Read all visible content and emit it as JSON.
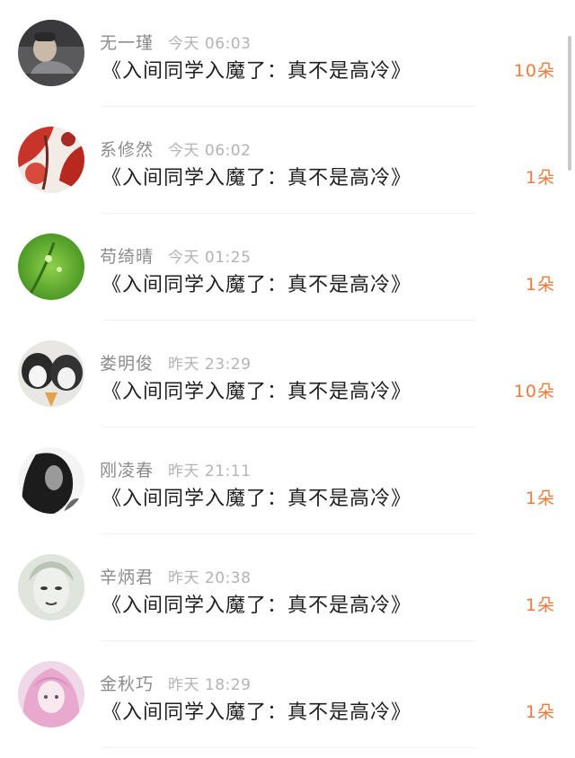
{
  "rows": [
    {
      "name": "无一瑾",
      "time": "今天 06:03",
      "title": "《入间同学入魔了：真不是高冷》",
      "count": "10朵",
      "avatar": "avatar-gray-person"
    },
    {
      "name": "系修然",
      "time": "今天 06:02",
      "title": "《入间同学入魔了：真不是高冷》",
      "count": "1朵",
      "avatar": "avatar-red-floral"
    },
    {
      "name": "苟绮晴",
      "time": "今天 01:25",
      "title": "《入间同学入魔了：真不是高冷》",
      "count": "1朵",
      "avatar": "avatar-green-plant"
    },
    {
      "name": "娄明俊",
      "time": "昨天 23:29",
      "title": "《入间同学入魔了：真不是高冷》",
      "count": "10朵",
      "avatar": "avatar-husky-dogs"
    },
    {
      "name": "刚凌春",
      "time": "昨天 21:11",
      "title": "《入间同学入魔了：真不是高冷》",
      "count": "1朵",
      "avatar": "avatar-bw-girl"
    },
    {
      "name": "辛炳君",
      "time": "昨天 20:38",
      "title": "《入间同学入魔了：真不是高冷》",
      "count": "1朵",
      "avatar": "avatar-sketch-face"
    },
    {
      "name": "金秋巧",
      "time": "昨天 18:29",
      "title": "《入间同学入魔了：真不是高冷》",
      "count": "1朵",
      "avatar": "avatar-pink-anime"
    }
  ],
  "colors": {
    "accent": "#ef7a3a",
    "name": "#8c8c8c",
    "time": "#b3b3b3",
    "title": "#1f1f1f"
  }
}
